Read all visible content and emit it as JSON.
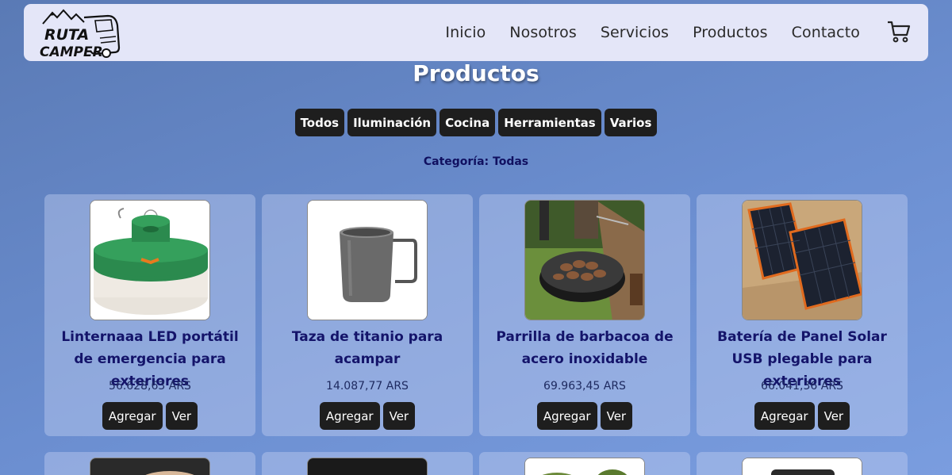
{
  "nav": {
    "logo_text_1": "RUTA",
    "logo_text_2": "CAMPER",
    "links": [
      "Inicio",
      "Nosotros",
      "Servicios",
      "Productos",
      "Contacto"
    ],
    "cart_icon": "cart-icon"
  },
  "page": {
    "title": "Productos",
    "category_label": "Categoría: Todas"
  },
  "filters": [
    "Todos",
    "Iluminación",
    "Cocina",
    "Herramientas",
    "Varios"
  ],
  "products": [
    {
      "name": "Linternaaa LED portátil de emergencia para exteriores",
      "price": "56.628,63 ARS",
      "add_label": "Agregar",
      "view_label": "Ver",
      "image": "green-led-lantern"
    },
    {
      "name": "Taza de titanio para acampar",
      "price": "14.087,77 ARS",
      "add_label": "Agregar",
      "view_label": "Ver",
      "image": "titanium-mug"
    },
    {
      "name": "Parrilla de barbacoa de acero inoxidable",
      "price": "69.963,45 ARS",
      "add_label": "Agregar",
      "view_label": "Ver",
      "image": "bbq-grill"
    },
    {
      "name": "Batería de Panel Solar USB plegable para exteriores",
      "price": "66.041,36 ARS",
      "add_label": "Agregar",
      "view_label": "Ver",
      "image": "solar-panels"
    }
  ],
  "colors": {
    "navbar_bg": "#e4e6f8",
    "button_bg": "#1e1e1e",
    "product_name": "#14146a"
  }
}
